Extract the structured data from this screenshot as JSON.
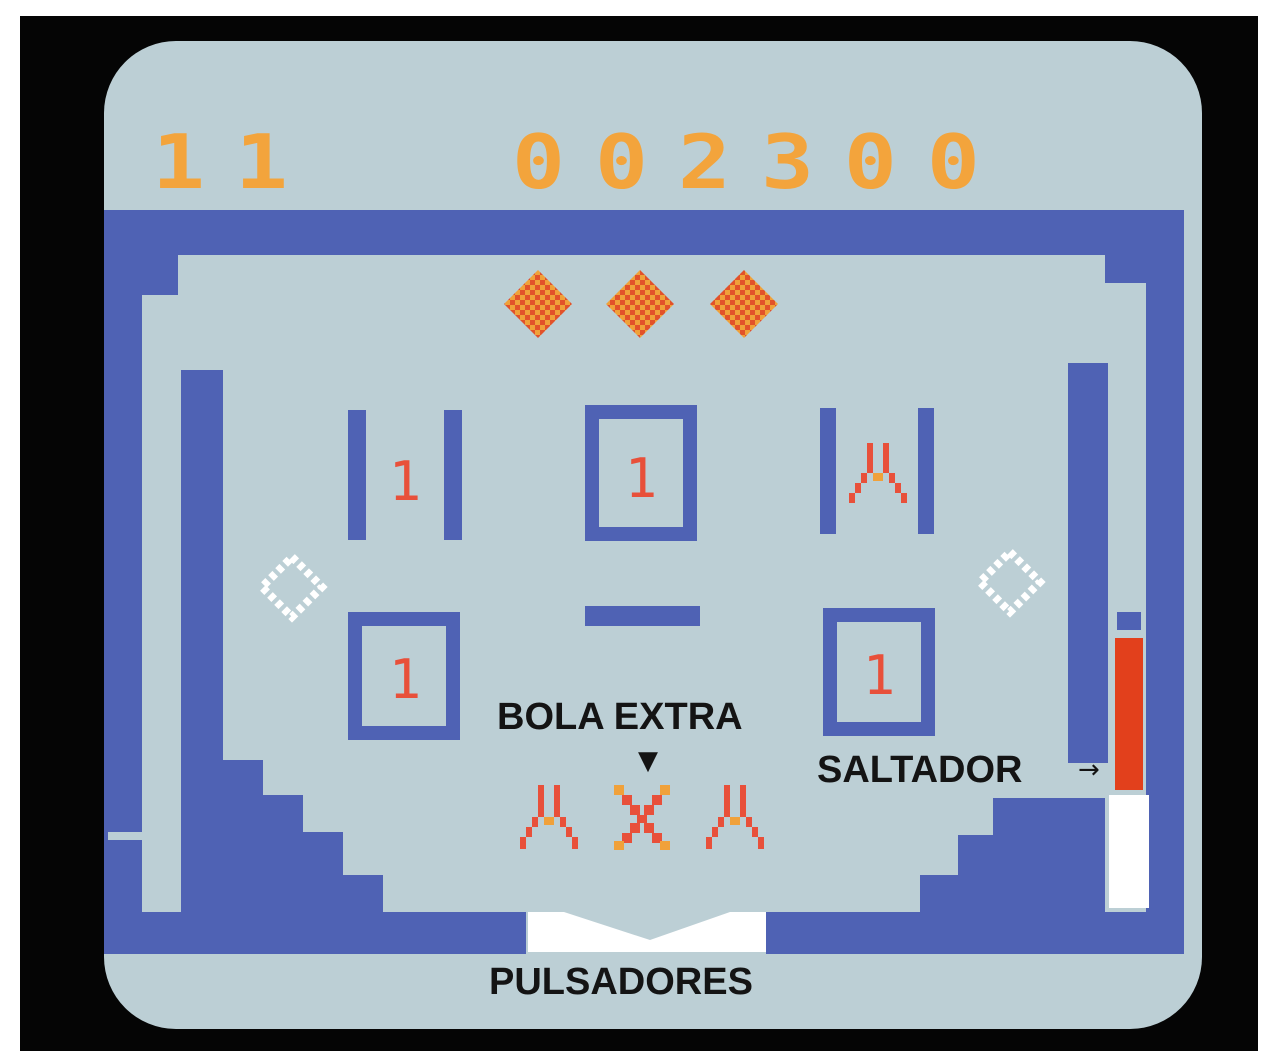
{
  "game": "Pinball",
  "score": {
    "left": "11",
    "right": "002300"
  },
  "targets": {
    "top_left": "1",
    "top_center": "1",
    "bottom_left": "1",
    "bottom_right": "1"
  },
  "labels": {
    "extra_ball": "BOLA EXTRA",
    "plunger": "SALTADOR",
    "flippers": "PULSADORES"
  },
  "arrows": {
    "down": "▼",
    "right": "→"
  },
  "colors": {
    "background": "#bccfd5",
    "walls": "#4f62b4",
    "score": "#f3a43c",
    "targets": "#e8503a",
    "plunger": "#e2401c"
  }
}
